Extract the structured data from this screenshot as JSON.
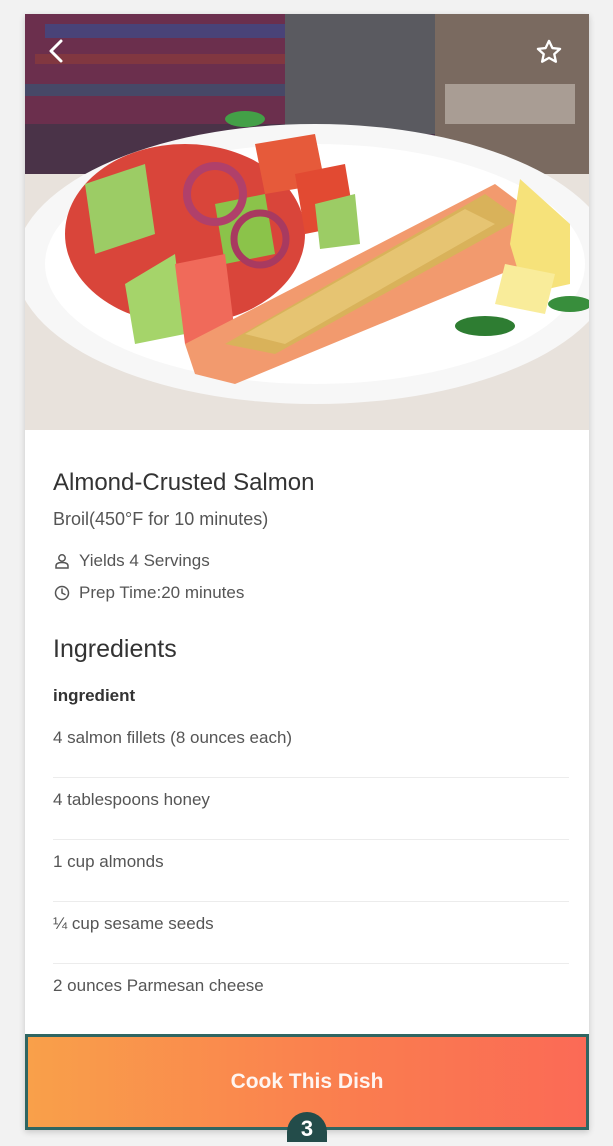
{
  "recipe": {
    "title": "Almond-Crusted Salmon",
    "method": "Broil(450°F for 10 minutes)",
    "servings": "Yields 4 Servings",
    "prep_time": "Prep Time:20 minutes"
  },
  "ingredients": {
    "heading": "Ingredients",
    "group_label": "ingredient",
    "items": [
      "4 salmon fillets (8 ounces each)",
      "4 tablespoons honey",
      "1 cup almonds",
      "¼ cup sesame seeds",
      "2 ounces Parmesan cheese"
    ]
  },
  "cta": {
    "label": "Cook This Dish"
  },
  "badge": {
    "count": "3"
  },
  "icons": {
    "back": "chevron-left-icon",
    "favorite": "star-outline-icon",
    "servings": "person-icon",
    "prep": "clock-icon"
  },
  "colors": {
    "cta_start": "#f9a04a",
    "cta_end": "#fb6a56",
    "cta_border": "#2f6662",
    "badge": "#234c4a"
  }
}
